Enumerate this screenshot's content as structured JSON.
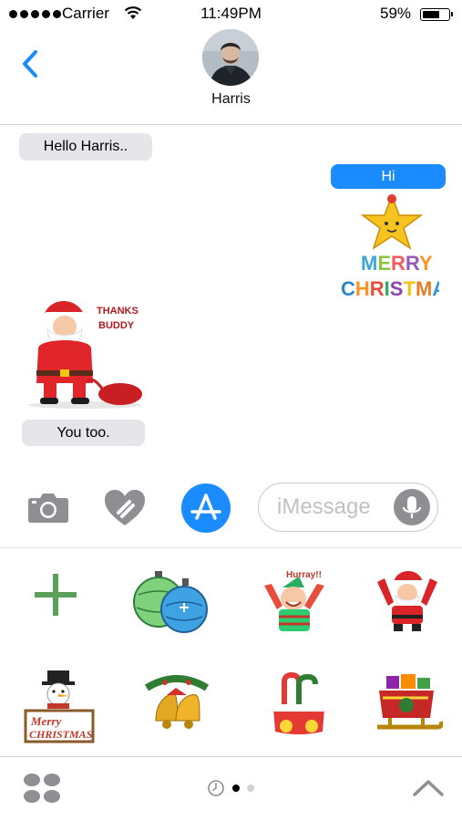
{
  "status_bar": {
    "carrier": "Carrier",
    "time": "11:49PM",
    "battery_percent": "59%",
    "battery_level": 0.59,
    "signal_bars": 5
  },
  "header": {
    "contact_name": "Harris",
    "back_icon": "chevron-left-icon"
  },
  "conversation": {
    "messages": [
      {
        "direction": "incoming",
        "text": "Hello Harris.."
      },
      {
        "direction": "outgoing",
        "text": "Hi"
      },
      {
        "direction": "outgoing",
        "sticker": "merry-christmas-star-sticker",
        "sticker_text": "MERRY CHRISTMAS"
      },
      {
        "direction": "incoming",
        "sticker": "santa-thanks-buddy-sticker",
        "sticker_text": "THANKS BUDDY"
      },
      {
        "direction": "incoming",
        "text": "You too."
      }
    ]
  },
  "input_bar": {
    "camera_icon": "camera-icon",
    "digital_touch_icon": "heart-hand-icon",
    "app_store_icon": "app-store-icon",
    "placeholder": "iMessage",
    "mic_icon": "microphone-icon"
  },
  "sticker_drawer": {
    "items": [
      {
        "name": "add-sticker",
        "icon": "plus-icon"
      },
      {
        "name": "christmas-ornaments-sticker"
      },
      {
        "name": "elf-hurray-sticker",
        "text": "Hurray!!"
      },
      {
        "name": "santa-waving-sticker"
      },
      {
        "name": "snowman-merry-christmas-sticker",
        "text": "MERRY CHRISTMAS"
      },
      {
        "name": "christmas-bells-sticker"
      },
      {
        "name": "candy-canes-stocking-sticker"
      },
      {
        "name": "sleigh-gifts-sticker"
      }
    ],
    "colors": {
      "accent": "#1a8cff",
      "plus": "#5aa05a"
    }
  },
  "bottom_bar": {
    "apps_icon": "app-grid-icon",
    "recents_icon": "clock-icon",
    "page_count": 2,
    "current_page": 1,
    "expand_icon": "chevron-up-icon"
  }
}
